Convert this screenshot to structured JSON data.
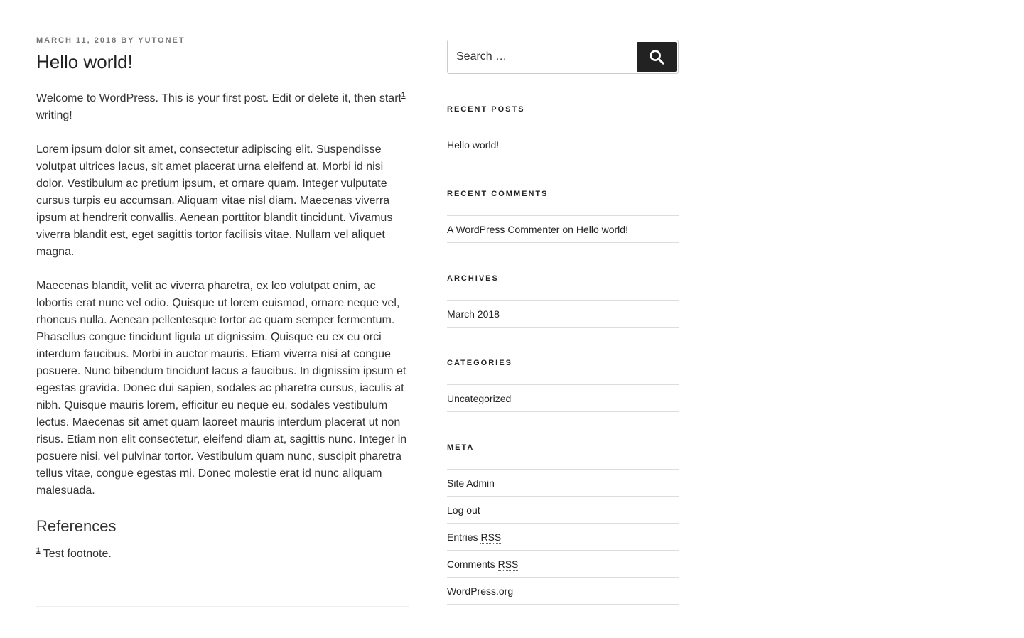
{
  "post": {
    "meta": {
      "date": "MARCH 11, 2018",
      "by": "BY",
      "author": "YUTONET"
    },
    "title": "Hello world!",
    "paragraph1_before": "Welcome to WordPress. This is your first post. Edit or delete it, then start",
    "paragraph1_footnote": "1",
    "paragraph1_after": " writing!",
    "paragraph2": "Lorem ipsum dolor sit amet, consectetur adipiscing elit. Suspendisse volutpat ultrices lacus, sit amet placerat urna eleifend at. Morbi id nisi dolor. Vestibulum ac pretium ipsum, et ornare quam. Integer vulputate cursus turpis eu accumsan. Aliquam vitae nisl diam. Maecenas viverra ipsum at hendrerit convallis. Aenean porttitor blandit tincidunt. Vivamus viverra blandit est, eget sagittis tortor facilisis vitae. Nullam vel aliquet magna.",
    "paragraph3": "Maecenas blandit, velit ac viverra pharetra, ex leo volutpat enim, ac lobortis erat nunc vel odio. Quisque ut lorem euismod, ornare neque vel, rhoncus nulla. Aenean pellentesque tortor ac quam semper fermentum. Phasellus congue tincidunt ligula ut dignissim. Quisque eu ex eu orci interdum faucibus. Morbi in auctor mauris. Etiam viverra nisi at congue posuere. Nunc bibendum tincidunt lacus a faucibus. In dignissim ipsum et egestas gravida. Donec dui sapien, sodales ac pharetra cursus, iaculis at nibh. Quisque mauris lorem, efficitur eu neque eu, sodales vestibulum lectus. Maecenas sit amet quam laoreet mauris interdum placerat ut non risus. Etiam non elit consectetur, eleifend diam at, sagittis nunc. Integer in posuere nisi, vel pulvinar tortor. Vestibulum quam nunc, suscipit pharetra tellus vitae, congue egestas mi. Donec molestie erat id nunc aliquam malesuada.",
    "references_heading": "References",
    "footnote_number": "1",
    "footnote_text": " Test footnote."
  },
  "sidebar": {
    "search": {
      "placeholder": "Search …",
      "button_icon": "search-icon"
    },
    "recent_posts": {
      "title": "RECENT POSTS",
      "items": [
        "Hello world!"
      ]
    },
    "recent_comments": {
      "title": "RECENT COMMENTS",
      "author": "A WordPress Commenter",
      "on": "on",
      "post": "Hello world!"
    },
    "archives": {
      "title": "ARCHIVES",
      "items": [
        "March 2018"
      ]
    },
    "categories": {
      "title": "CATEGORIES",
      "items": [
        "Uncategorized"
      ]
    },
    "meta": {
      "title": "META",
      "site_admin": "Site Admin",
      "log_out": "Log out",
      "entries": "Entries",
      "comments": "Comments",
      "rss": "RSS",
      "wordpress_org": "WordPress.org"
    }
  }
}
